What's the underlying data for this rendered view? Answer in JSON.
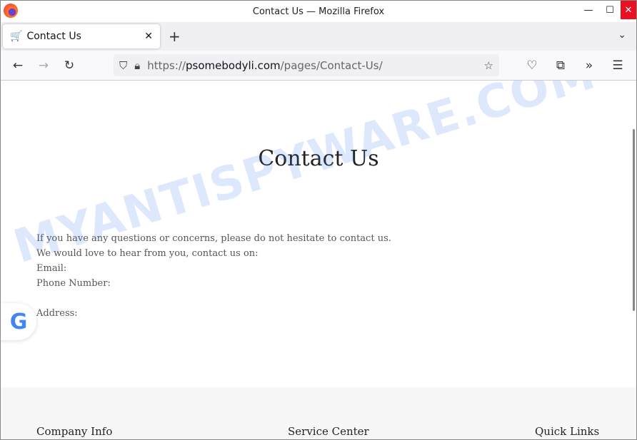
{
  "window": {
    "title": "Contact Us — Mozilla Firefox"
  },
  "tab": {
    "label": "Contact Us"
  },
  "url": {
    "scheme": "https://",
    "domain": "psomebodyli.com",
    "path": "/pages/Contact-Us/"
  },
  "page": {
    "title": "Contact Us",
    "lines": [
      "If you have any questions or concerns, please do not hesitate to contact us.",
      "We would love to hear from you, contact us on:",
      "Email:",
      "Phone Number:",
      "Address:"
    ]
  },
  "footer": {
    "headings": [
      "Company Info",
      "Service Center",
      "Quick Links"
    ]
  },
  "watermark": "MYANTISPYWARE.COM",
  "colors": {
    "close_button": "#e81123",
    "google_blue": "#4285f4"
  }
}
